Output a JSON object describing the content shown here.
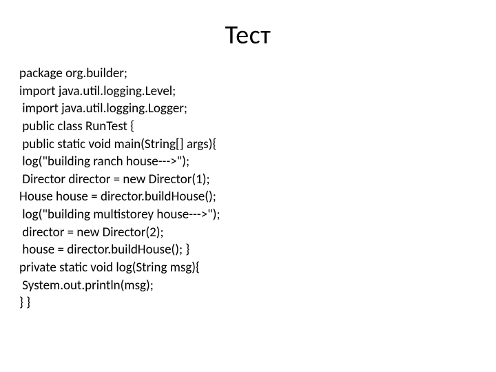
{
  "title": "Тест",
  "code": {
    "lines": [
      "рackage org.builder;",
      "import java.util.logging.Level;",
      " import java.util.logging.Logger;",
      " public class RunTest {",
      " public static void main(String[] args){",
      " log(\"building ranch house--->\");",
      " Director director = new Director(1);",
      "House house = director.buildHouse();",
      " log(\"building multistorey house--->\");",
      " director = new Director(2);",
      " house = director.buildHouse(); }",
      "private static void log(String msg){",
      " System.out.println(msg);",
      "} }"
    ]
  }
}
